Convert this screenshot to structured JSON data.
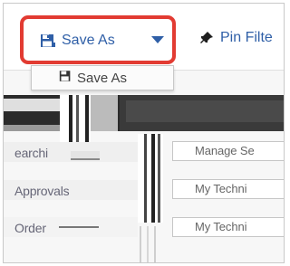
{
  "toolbar": {
    "save_as_label": "Save As",
    "pin_label": "Pin Filte"
  },
  "dropdown": {
    "item_label": "Save As"
  },
  "rows": [
    {
      "label": "earchi"
    },
    {
      "label": "Approvals"
    },
    {
      "label": "Order"
    }
  ],
  "right_list": [
    {
      "label": "Manage Se"
    },
    {
      "label": "My Techni"
    },
    {
      "label": "My Techni"
    }
  ],
  "colors": {
    "accent": "#2f5fa7",
    "highlight": "#e23b32"
  },
  "icons": {
    "save": "save-icon",
    "caret": "caret-down-icon",
    "pin": "pin-icon"
  }
}
